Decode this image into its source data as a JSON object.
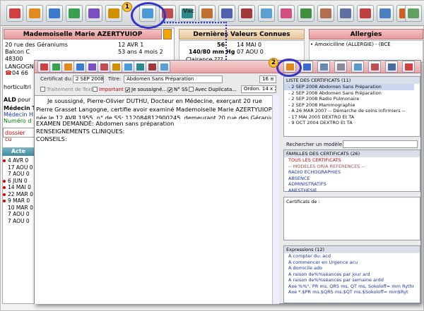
{
  "toolbar": {
    "buttons": [
      "toolbar-button-1",
      "toolbar-button-2",
      "toolbar-button-3",
      "toolbar-button-4",
      "toolbar-button-5",
      "toolbar-button-6",
      "certificate-button",
      "toolbar-button-8",
      "toolbar-button-9",
      "toolbar-button-10",
      "toolbar-button-11",
      "toolbar-button-12",
      "toolbar-button-13",
      "toolbar-button-14",
      "toolbar-button-15",
      "toolbar-button-16",
      "toolbar-button-17",
      "toolbar-button-18",
      "toolbar-button-19",
      "toolbar-button-20",
      "toolbar-button-21"
    ],
    "partial_label": "Vac"
  },
  "callouts": {
    "one": "1",
    "two": "2"
  },
  "patient": {
    "header": "Mademoiselle Marie AZERTYUIOP",
    "addr1": "20 rue des Géraniums",
    "addr2": "Balcon C",
    "postcode": "48300",
    "city": "LANGOGNE",
    "phone_prefix": "04 66",
    "birth_date": "12 AVR 1",
    "age": "53 ans 4 mois 2",
    "job_prefix": "horticultri",
    "ald_label": "ALD",
    "ald_value": "pour",
    "doctor_label": "Médecin T",
    "doctor_name": "Médecin H",
    "number_label": "Numéro d",
    "dossier_input": "dossier cu"
  },
  "last_values": {
    "header": "Dernières Valeurs Connues",
    "weight": "56",
    "weight_date": "14 MAI 0",
    "bp": "140/80 mm Hg",
    "bp_date": "07 AOU 0",
    "clearance": "Clairance ???"
  },
  "allergies": {
    "header": "Allergies",
    "item": "• Amoxicilline (ALLERGIE) - (BCE"
  },
  "acts": {
    "header": "Acte",
    "dates": [
      "4 AVR 0",
      "17 AOU 0",
      "7 AOU 0",
      "6 JUN 0",
      "14 MAI 0",
      "22 MAR 0",
      "9 MAR 0",
      "10 MAR 0",
      "7 AOU 0",
      "7 AOU 0"
    ],
    "bullets": [
      true,
      false,
      false,
      true,
      true,
      true,
      true,
      false,
      false,
      false
    ]
  },
  "certificate": {
    "date_label": "Certificat du:",
    "date_value": "2 SEP 2008",
    "title_label": "Titre:",
    "title_value": "Abdomen Sans Préparation",
    "font_size": "16",
    "options": {
      "text_processing": "Traitement de Texte",
      "important": "Important",
      "signed": "Je soussigné...",
      "ss": "N° SS",
      "duplicate": "Avec Duplicata...",
      "order": "Ordon. 14 x 21"
    },
    "body_line1": "Je soussigné, Pierre-Olivier DUTHU, Docteur en Médecine, exerçant 20 rue",
    "body_line2": "Pierre Grasset Langogne, certifie avoir examiné Mademoiselle Marie AZERTYUIOP,",
    "body_line3": "née le 12 AVR 1955, n° de SS: 112084812900245, demeurant 20 rue des Géraniums",
    "body_line4": "EXAMEN DEMANDÉ: Abdomen sans préparation",
    "body_line5": "RENSEIGNEMENTS CLINIQUES:",
    "body_line6": "CONSEILS:"
  },
  "cert_list": {
    "header": "LISTE DES CERTIFICATS (11)",
    "items": [
      "- 2 SEP 2008 Abdomen Sans Préparation",
      "- 2 SEP 2008 Abdomen Sans Préparation",
      "- 2 SEP 2008 Radio Pulmonaire",
      "- 2 SEP 2008 Mammographie",
      "- A 26 MAR 2007 -- Démarche de soins infirmiers --",
      "- 17 MAI 2005 DEXTRO Et TA",
      "- 9 OCT 2004 DEXTRO Et TA"
    ]
  },
  "search_model": {
    "label": "Rechercher un modèle:",
    "placeholder": ""
  },
  "families": {
    "header": "FAMILLES DES CERTIFICATS (26)",
    "items": [
      "TOUS LES CERTIFICATS",
      "-- MODELES ORIA REFERENCES --",
      "RADIO  ECHOGRAPHIES",
      "ABSENCE",
      "ADMINISTRATIFS",
      "ANESTHESIE"
    ]
  },
  "certs_of": {
    "label": "Certificats de :"
  },
  "expressions": {
    "header": "Expressions (12)",
    "items": [
      "A compter du:  acd",
      "A commencer en Urgence  acu",
      "A domicile  ado",
      "A raison de%%séances par jour  ard",
      "A raison de%%séances par semaine  ardd",
      "Axe %%°, PR ms, QRS ms, QT ms, Sokoloff= mm Rythme=",
      "Axe *.$PR ms.$QRS ms.$QT ms.$Sokoloff= mm$Ryt"
    ]
  },
  "colors": {
    "accent": "#3434c8",
    "header_red": "#e59a9a",
    "header_tan": "#e6c79e"
  }
}
